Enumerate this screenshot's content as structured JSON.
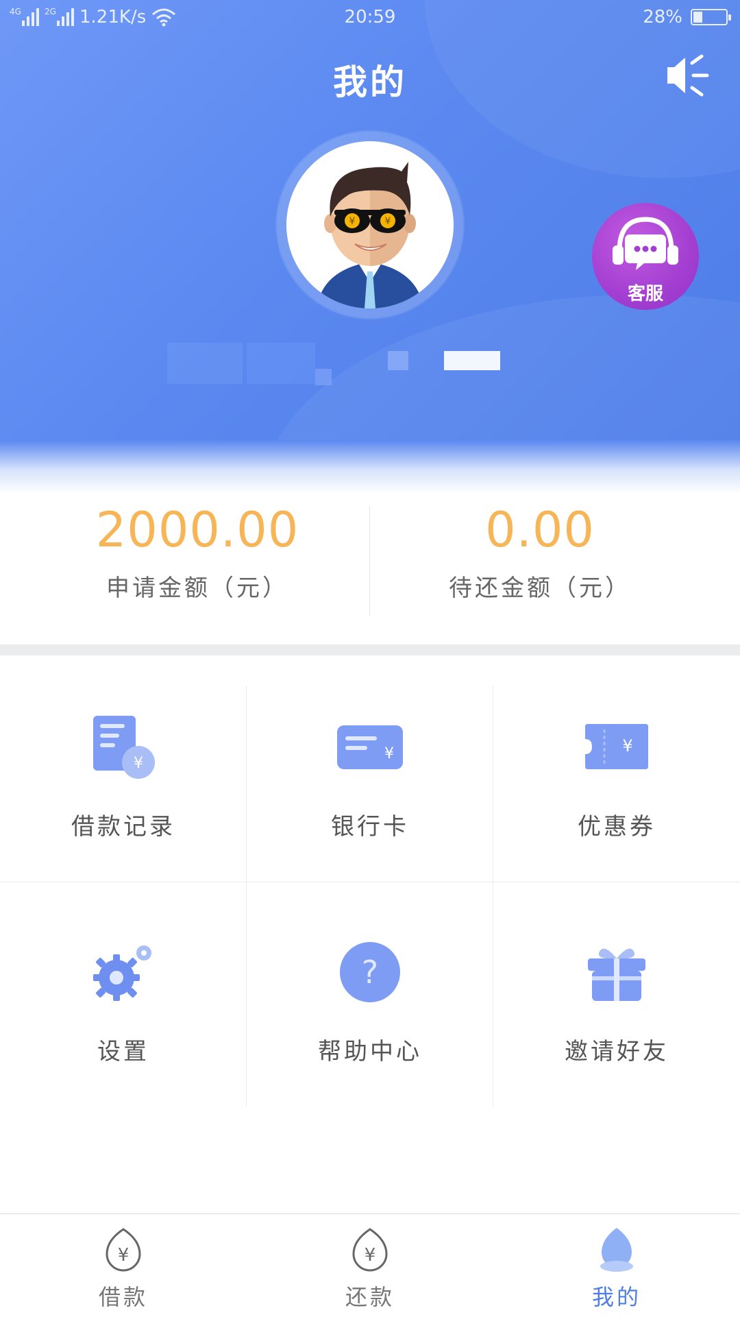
{
  "status_bar": {
    "net1": "4G",
    "net2": "2G",
    "speed": "1.21K/s",
    "time": "20:59",
    "battery": "28%",
    "battery_level": 0.28
  },
  "header": {
    "title": "我的",
    "mute_icon": "speaker-mute-icon",
    "customer_service_label": "客服"
  },
  "stats": {
    "applied": {
      "value": "2000.00",
      "label": "申请金额（元）"
    },
    "pending": {
      "value": "0.00",
      "label": "待还金额（元）"
    }
  },
  "grid": {
    "items": [
      {
        "label": "借款记录",
        "icon": "loan-record-icon"
      },
      {
        "label": "银行卡",
        "icon": "bank-card-icon"
      },
      {
        "label": "优惠券",
        "icon": "coupon-icon"
      },
      {
        "label": "设置",
        "icon": "gear-icon"
      },
      {
        "label": "帮助中心",
        "icon": "help-icon"
      },
      {
        "label": "邀请好友",
        "icon": "gift-icon"
      }
    ]
  },
  "tabbar": {
    "tabs": [
      {
        "label": "借款",
        "icon": "yen-drop-icon"
      },
      {
        "label": "还款",
        "icon": "yen-drop-icon"
      },
      {
        "label": "我的",
        "icon": "profile-drop-icon",
        "active": true
      }
    ]
  },
  "colors": {
    "header_blue": "#5b89f0",
    "amount_orange": "#f6b657",
    "service_purple": "#a33ed2",
    "active_tab": "#4f7ee6"
  }
}
